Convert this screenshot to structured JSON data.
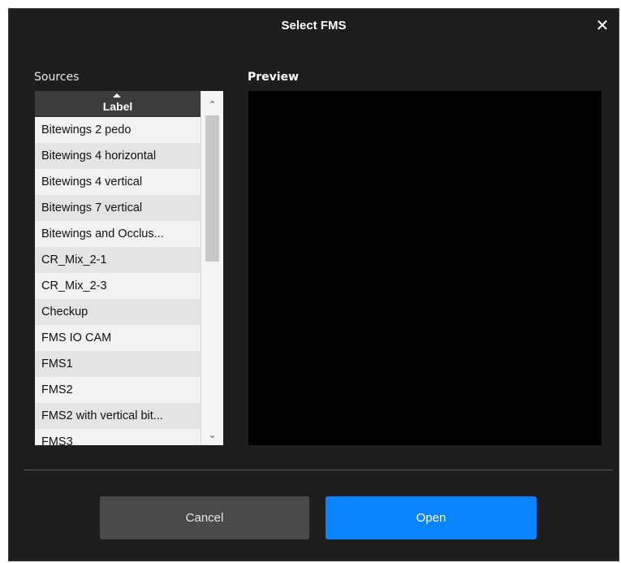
{
  "dialog": {
    "title": "Select FMS",
    "close_glyph": "✕"
  },
  "sources": {
    "label": "Sources",
    "column_header": "Label",
    "sort": "ascending",
    "items": [
      "Bitewings 2 pedo",
      "Bitewings 4 horizontal",
      "Bitewings 4 vertical",
      "Bitewings 7 vertical",
      "Bitewings and Occlus...",
      "CR_Mix_2-1",
      "CR_Mix_2-3",
      "Checkup",
      "FMS IO CAM",
      "FMS1",
      "FMS2",
      "FMS2 with vertical bit...",
      "FMS3"
    ],
    "scroll_up_glyph": "⌃",
    "scroll_down_glyph": "⌄"
  },
  "preview": {
    "label": "Preview"
  },
  "buttons": {
    "cancel_label": "Cancel",
    "open_label": "Open"
  },
  "colors": {
    "dialog_bg": "#1e1e1e",
    "accent": "#0a84ff",
    "cancel_bg": "#4a4a4a",
    "preview_bg": "#000000"
  }
}
